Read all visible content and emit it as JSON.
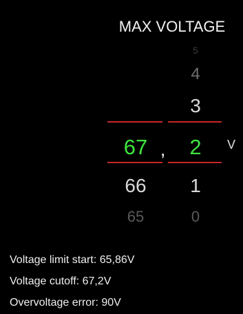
{
  "header": {
    "title": "MAX VOLTAGE"
  },
  "picker": {
    "integer_column": {
      "above": [],
      "selected": "67",
      "below": [
        "66",
        "65"
      ]
    },
    "decimal_column": {
      "above": [
        "5",
        "4",
        "3"
      ],
      "selected": "2",
      "below": [
        "1",
        "0"
      ]
    },
    "separator": ",",
    "unit": "V",
    "selected_value": "67,2"
  },
  "info": {
    "limit_start": "Voltage limit start: 65,86V",
    "cutoff": "Voltage cutoff: 67,2V",
    "overvoltage": "Overvoltage error: 90V"
  },
  "colors": {
    "background": "#000000",
    "selected": "#3ee53e",
    "divider": "#c62828"
  }
}
